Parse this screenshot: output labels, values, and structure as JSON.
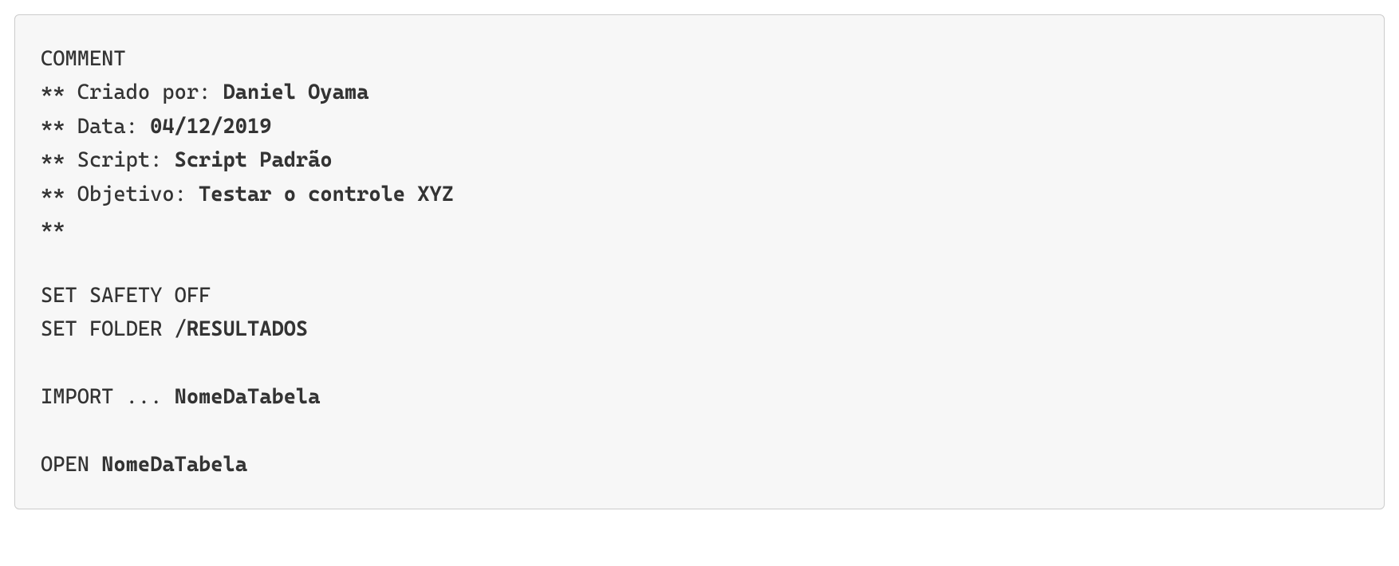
{
  "code": {
    "line1": "COMMENT",
    "line2_prefix": "** Criado por: ",
    "line2_bold": "Daniel Oyama",
    "line3_prefix": "** Data: ",
    "line3_bold": "04/12/2019",
    "line4_prefix": "** Script: ",
    "line4_bold": "Script Padrão",
    "line5_prefix": "** Objetivo: ",
    "line5_bold": "Testar o controle XYZ",
    "line6": "**",
    "line7": "",
    "line8": "SET SAFETY OFF",
    "line9_prefix": "SET FOLDER /",
    "line9_bold": "RESULTADOS",
    "line10": "",
    "line11_prefix": "IMPORT ... ",
    "line11_bold": "NomeDaTabela",
    "line12": "",
    "line13_prefix": "OPEN ",
    "line13_bold": "NomeDaTabela"
  }
}
